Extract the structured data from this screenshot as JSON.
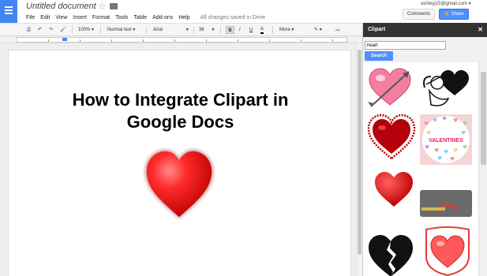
{
  "header": {
    "doc_title": "Untitled document",
    "account": "ashleyj15@gmail.com",
    "comments_label": "Comments",
    "share_label": "Share",
    "menu": [
      "File",
      "Edit",
      "View",
      "Insert",
      "Format",
      "Tools",
      "Table",
      "Add-ons",
      "Help"
    ],
    "save_status": "All changes saved in Drive"
  },
  "toolbar": {
    "zoom": "100%",
    "style": "Normal text",
    "font": "Arial",
    "size": "36",
    "bold": "B",
    "italic": "I",
    "underline": "U",
    "text_color": "A",
    "more": "More"
  },
  "document": {
    "heading_line1": "How to Integrate Clipart in",
    "heading_line2": "Google Docs"
  },
  "clipart": {
    "title": "Clipart",
    "close": "✕",
    "search_value": "heart",
    "search_button": "Search",
    "thumb3_text": "VALENTINES"
  },
  "colors": {
    "docs_blue": "#4285f4",
    "share_blue": "#4d90fe",
    "panel_header": "#333333",
    "heart_red": "#e02020"
  }
}
